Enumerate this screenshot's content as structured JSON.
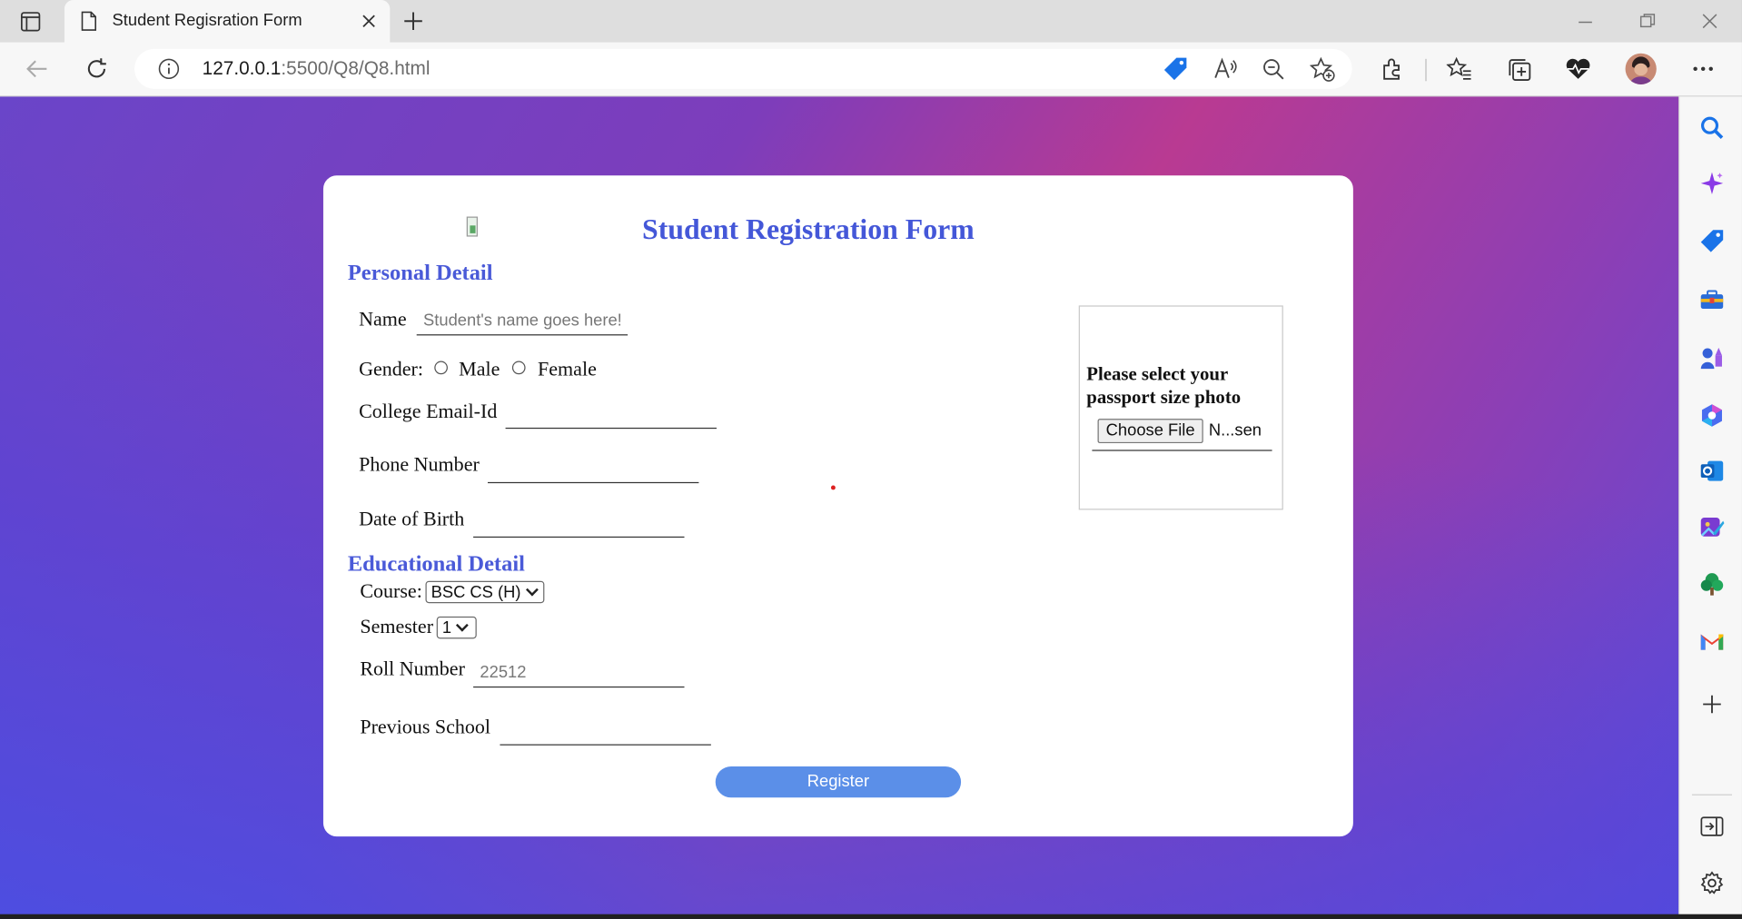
{
  "browser": {
    "tab_title": "Student Regisration Form",
    "url_host": "127.0.0.1",
    "url_path": ":5500/Q8/Q8.html"
  },
  "form": {
    "title": "Student Registration Form",
    "personal_heading": "Personal Detail",
    "name_label": "Name",
    "name_placeholder": "Student's name goes here!",
    "gender_label": "Gender:",
    "gender_options": [
      "Male",
      "Female"
    ],
    "email_label": "College Email-Id",
    "phone_label": "Phone Number",
    "dob_label": "Date of Birth",
    "educational_heading": "Educational Detail",
    "course_label": "Course:",
    "course_value": "BSC CS (H)",
    "semester_label": "Semester",
    "semester_value": "1",
    "roll_label": "Roll Number",
    "roll_placeholder": "22512",
    "school_label": "Previous School",
    "register_label": "Register",
    "photo": {
      "prompt": "Please select your passport size photo",
      "button_label": "Choose File",
      "file_status": "N...sen"
    }
  },
  "colors": {
    "heading": "#4457d8",
    "register_button": "#5b8fe8"
  },
  "icons": {
    "sidebar": [
      "search-icon",
      "copilot-icon",
      "shopping-tag-icon",
      "toolbox-icon",
      "games-icon",
      "microsoft365-icon",
      "outlook-icon",
      "designer-icon",
      "tree-icon",
      "gmail-icon",
      "add-icon",
      "hide-sidebar-icon",
      "settings-icon"
    ]
  }
}
